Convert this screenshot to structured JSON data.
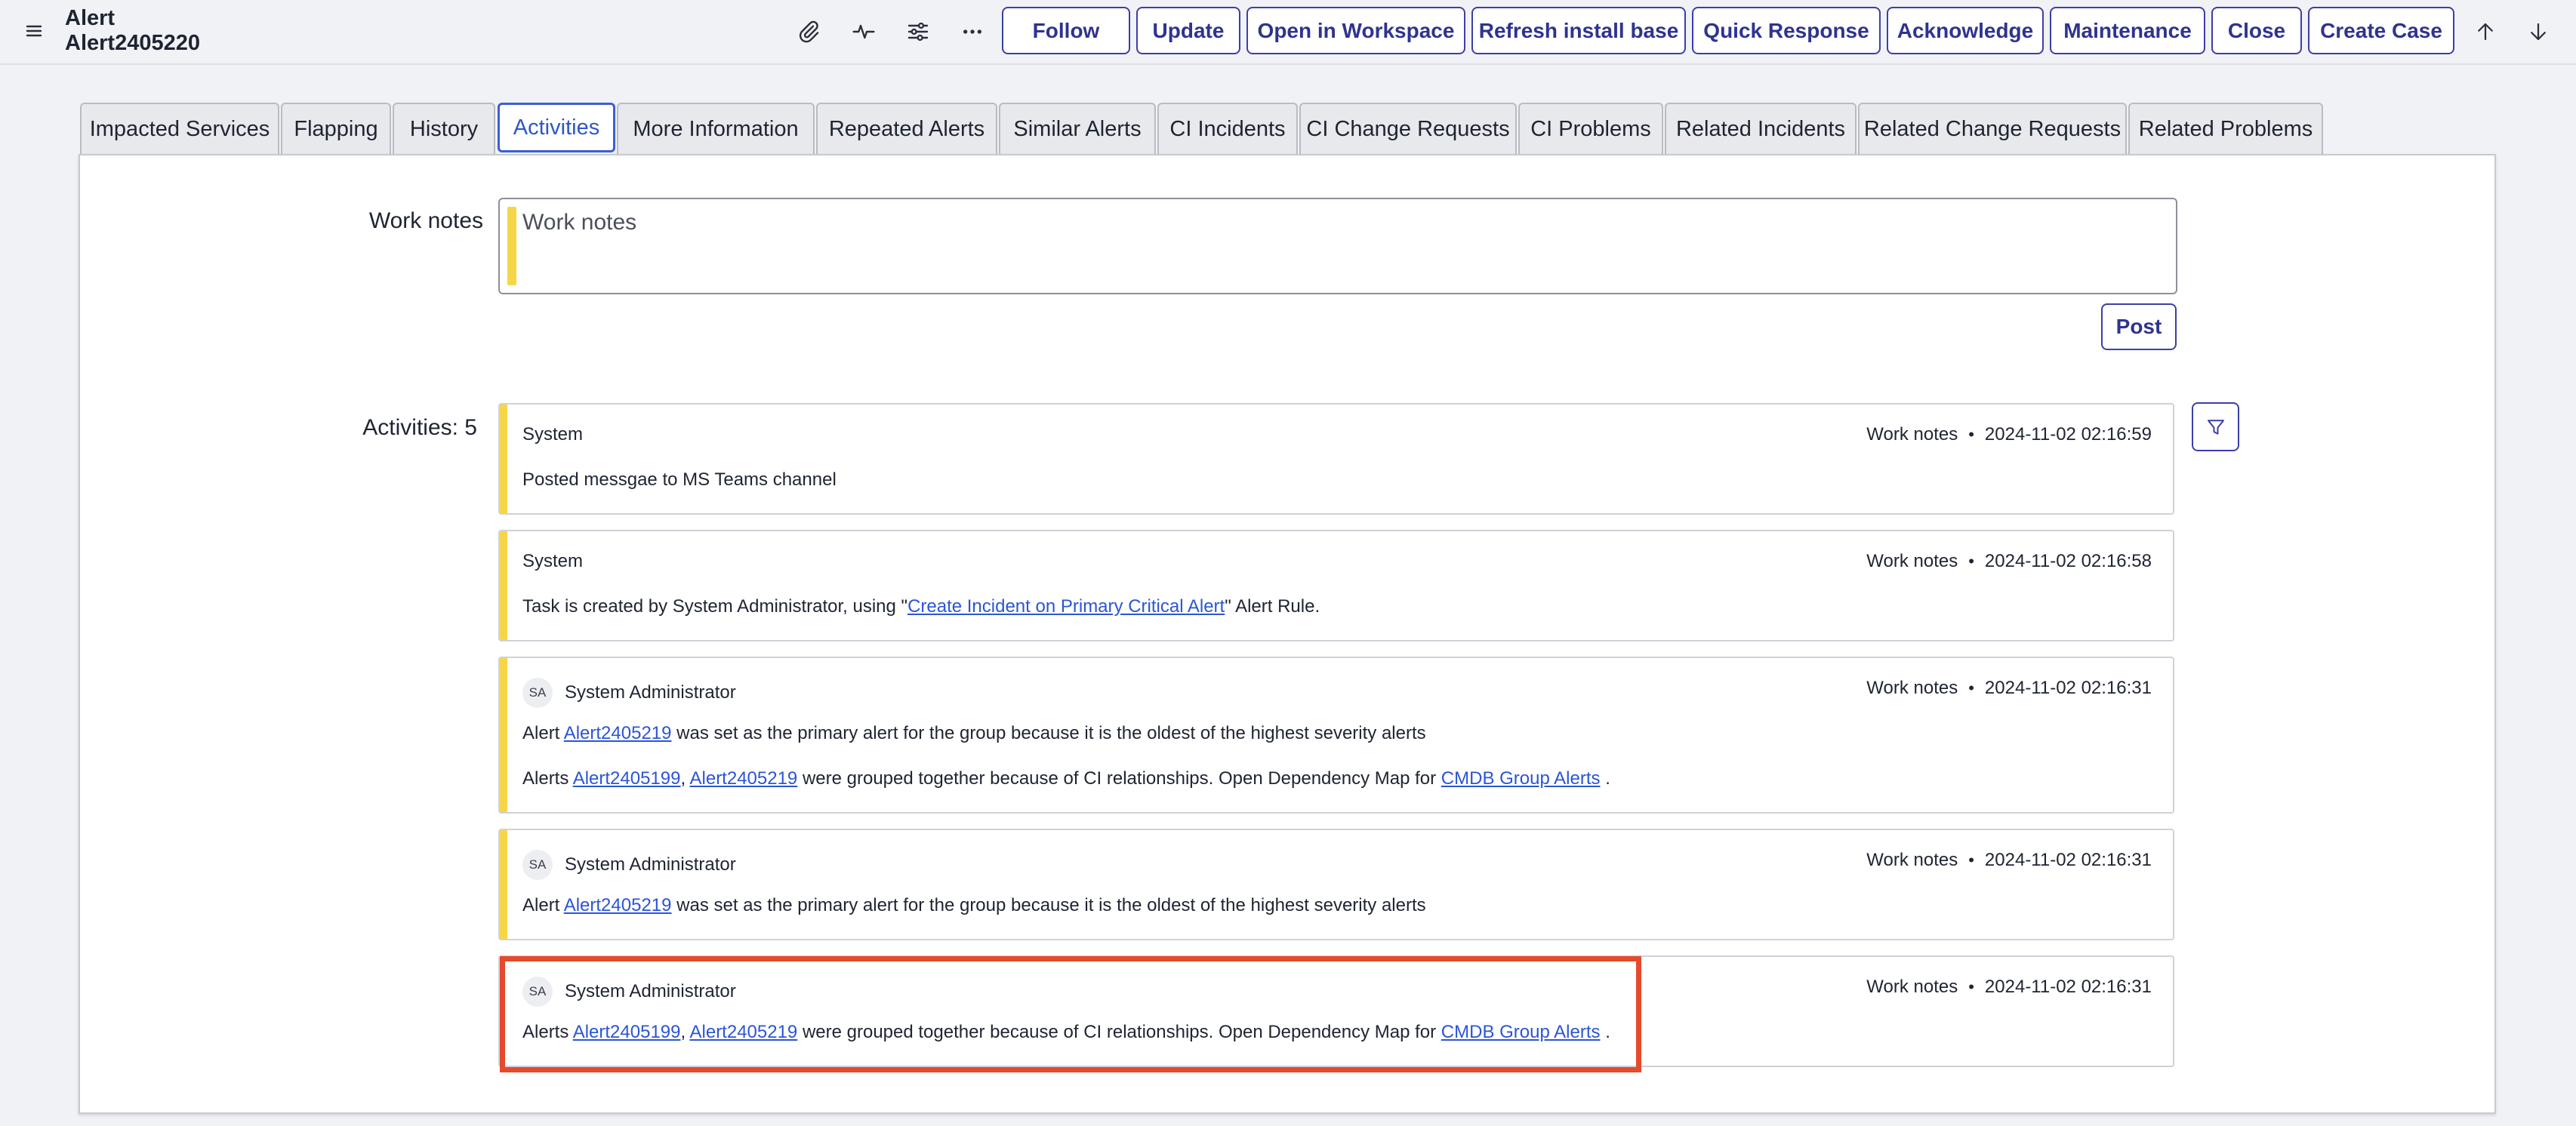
{
  "header": {
    "title_line1": "Alert",
    "title_line2": "Alert2405220",
    "icons": [
      "menu-icon",
      "paperclip-icon",
      "pulse-icon",
      "sliders-icon",
      "more-icon"
    ],
    "buttons": [
      "Follow",
      "Update",
      "Open in Workspace",
      "Refresh install base",
      "Quick Response",
      "Acknowledge",
      "Maintenance",
      "Close",
      "Create Case"
    ],
    "nav_icons": [
      "arrow-up-icon",
      "arrow-down-icon"
    ]
  },
  "tabs": [
    "Impacted Services",
    "Flapping",
    "History",
    "Activities",
    "More Information",
    "Repeated Alerts",
    "Similar Alerts",
    "CI Incidents",
    "CI Change Requests",
    "CI Problems",
    "Related Incidents",
    "Related Change Requests",
    "Related Problems"
  ],
  "active_tab": "Activities",
  "work_notes": {
    "label": "Work notes",
    "placeholder": "Work notes",
    "value": "",
    "post_label": "Post"
  },
  "activities": {
    "label": "Activities: 5",
    "filter_icon": "filter-icon",
    "items": [
      {
        "author": "System",
        "avatar": "",
        "type": "Work notes",
        "time": "2024-11-02 02:16:59",
        "line1": {
          "pre": "Posted messgae to MS Teams channel"
        }
      },
      {
        "author": "System",
        "avatar": "",
        "type": "Work notes",
        "time": "2024-11-02 02:16:58",
        "line1": {
          "pre": "Task is created by System Administrator, using \"",
          "link": "Create Incident on Primary Critical Alert",
          "post": "\" Alert Rule."
        }
      },
      {
        "author": "System Administrator",
        "avatar": "SA",
        "type": "Work notes",
        "time": "2024-11-02 02:16:31",
        "line1": {
          "pre": "Alert ",
          "link": "Alert2405219",
          "post": " was set as the primary alert for the group because it is the oldest of the highest severity alerts"
        },
        "line2": {
          "pre": "Alerts ",
          "link1": "Alert2405199",
          "sep": ", ",
          "link2": "Alert2405219",
          "mid": " were grouped together because of CI relationships. Open Dependency Map for ",
          "link3": "CMDB Group Alerts",
          "post": " ."
        }
      },
      {
        "author": "System Administrator",
        "avatar": "SA",
        "type": "Work notes",
        "time": "2024-11-02 02:16:31",
        "line1": {
          "pre": "Alert ",
          "link": "Alert2405219",
          "post": " was set as the primary alert for the group because it is the oldest of the highest severity alerts"
        }
      },
      {
        "author": "System Administrator",
        "avatar": "SA",
        "type": "Work notes",
        "time": "2024-11-02 02:16:31",
        "line1": {
          "pre": "Alerts ",
          "link1": "Alert2405199",
          "sep": ", ",
          "link2": "Alert2405219",
          "mid": " were grouped together because of CI relationships. Open Dependency Map for ",
          "link3": "CMDB Group Alerts",
          "post": " ."
        }
      }
    ]
  },
  "colors": {
    "accent": "#3b3fa8",
    "link": "#2b55d6",
    "work_note_bar": "#f6d646",
    "highlight": "#e54a2c"
  }
}
